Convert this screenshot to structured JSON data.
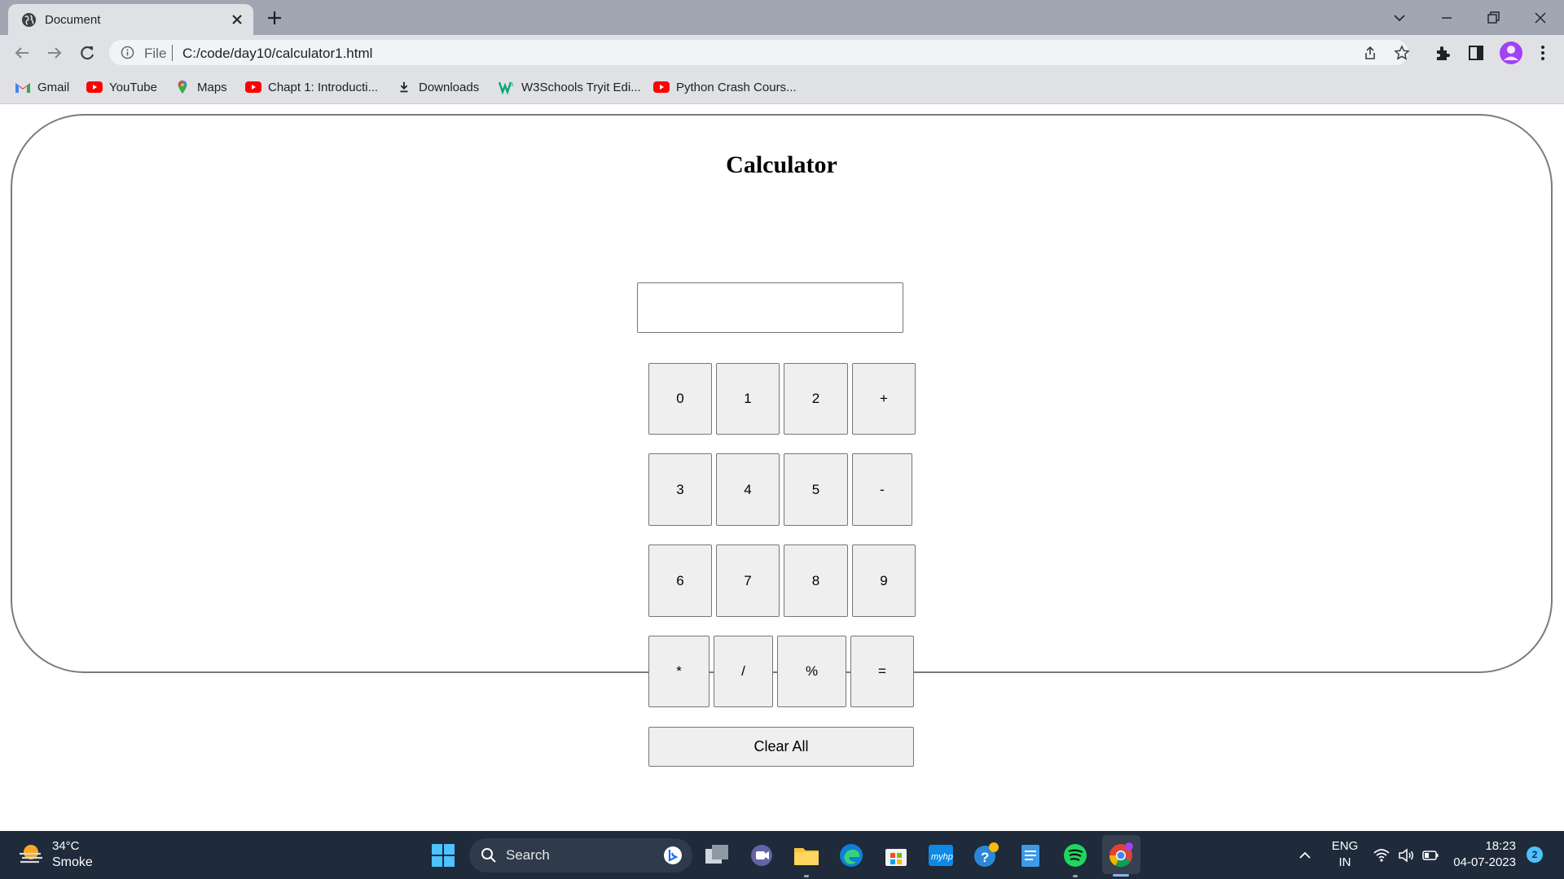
{
  "browser": {
    "tab_title": "Document",
    "omnibox": {
      "scheme_label": "File",
      "url": "C:/code/day10/calculator1.html"
    },
    "bookmarks": [
      {
        "label": "Gmail",
        "icon": "gmail-icon"
      },
      {
        "label": "YouTube",
        "icon": "youtube-icon"
      },
      {
        "label": "Maps",
        "icon": "maps-icon"
      },
      {
        "label": "Chapt 1: Introducti...",
        "icon": "youtube-icon"
      },
      {
        "label": "Downloads",
        "icon": "download-icon"
      },
      {
        "label": "W3Schools Tryit Edi...",
        "icon": "w3schools-icon"
      },
      {
        "label": "Python Crash Cours...",
        "icon": "youtube-icon"
      }
    ]
  },
  "calculator": {
    "title": "Calculator",
    "display_value": "",
    "rows": [
      [
        "0",
        "1",
        "2",
        "+"
      ],
      [
        "3",
        "4",
        "5",
        "-"
      ],
      [
        "6",
        "7",
        "8",
        "9"
      ],
      [
        "*",
        "/",
        "%",
        "="
      ]
    ],
    "clear_label": "Clear All"
  },
  "taskbar": {
    "weather_temp": "34°C",
    "weather_condition": "Smoke",
    "search_label": "Search",
    "language_top": "ENG",
    "language_bottom": "IN",
    "time": "18:23",
    "date": "04-07-2023",
    "notification_count": "2"
  },
  "colors": {
    "tabbar": "#a2a6b3",
    "toolbar": "#dfe1e5",
    "button_face": "#efefef",
    "button_border": "#767676",
    "frame_border": "#7b7b7b",
    "taskbar": "#1f2a3a"
  }
}
